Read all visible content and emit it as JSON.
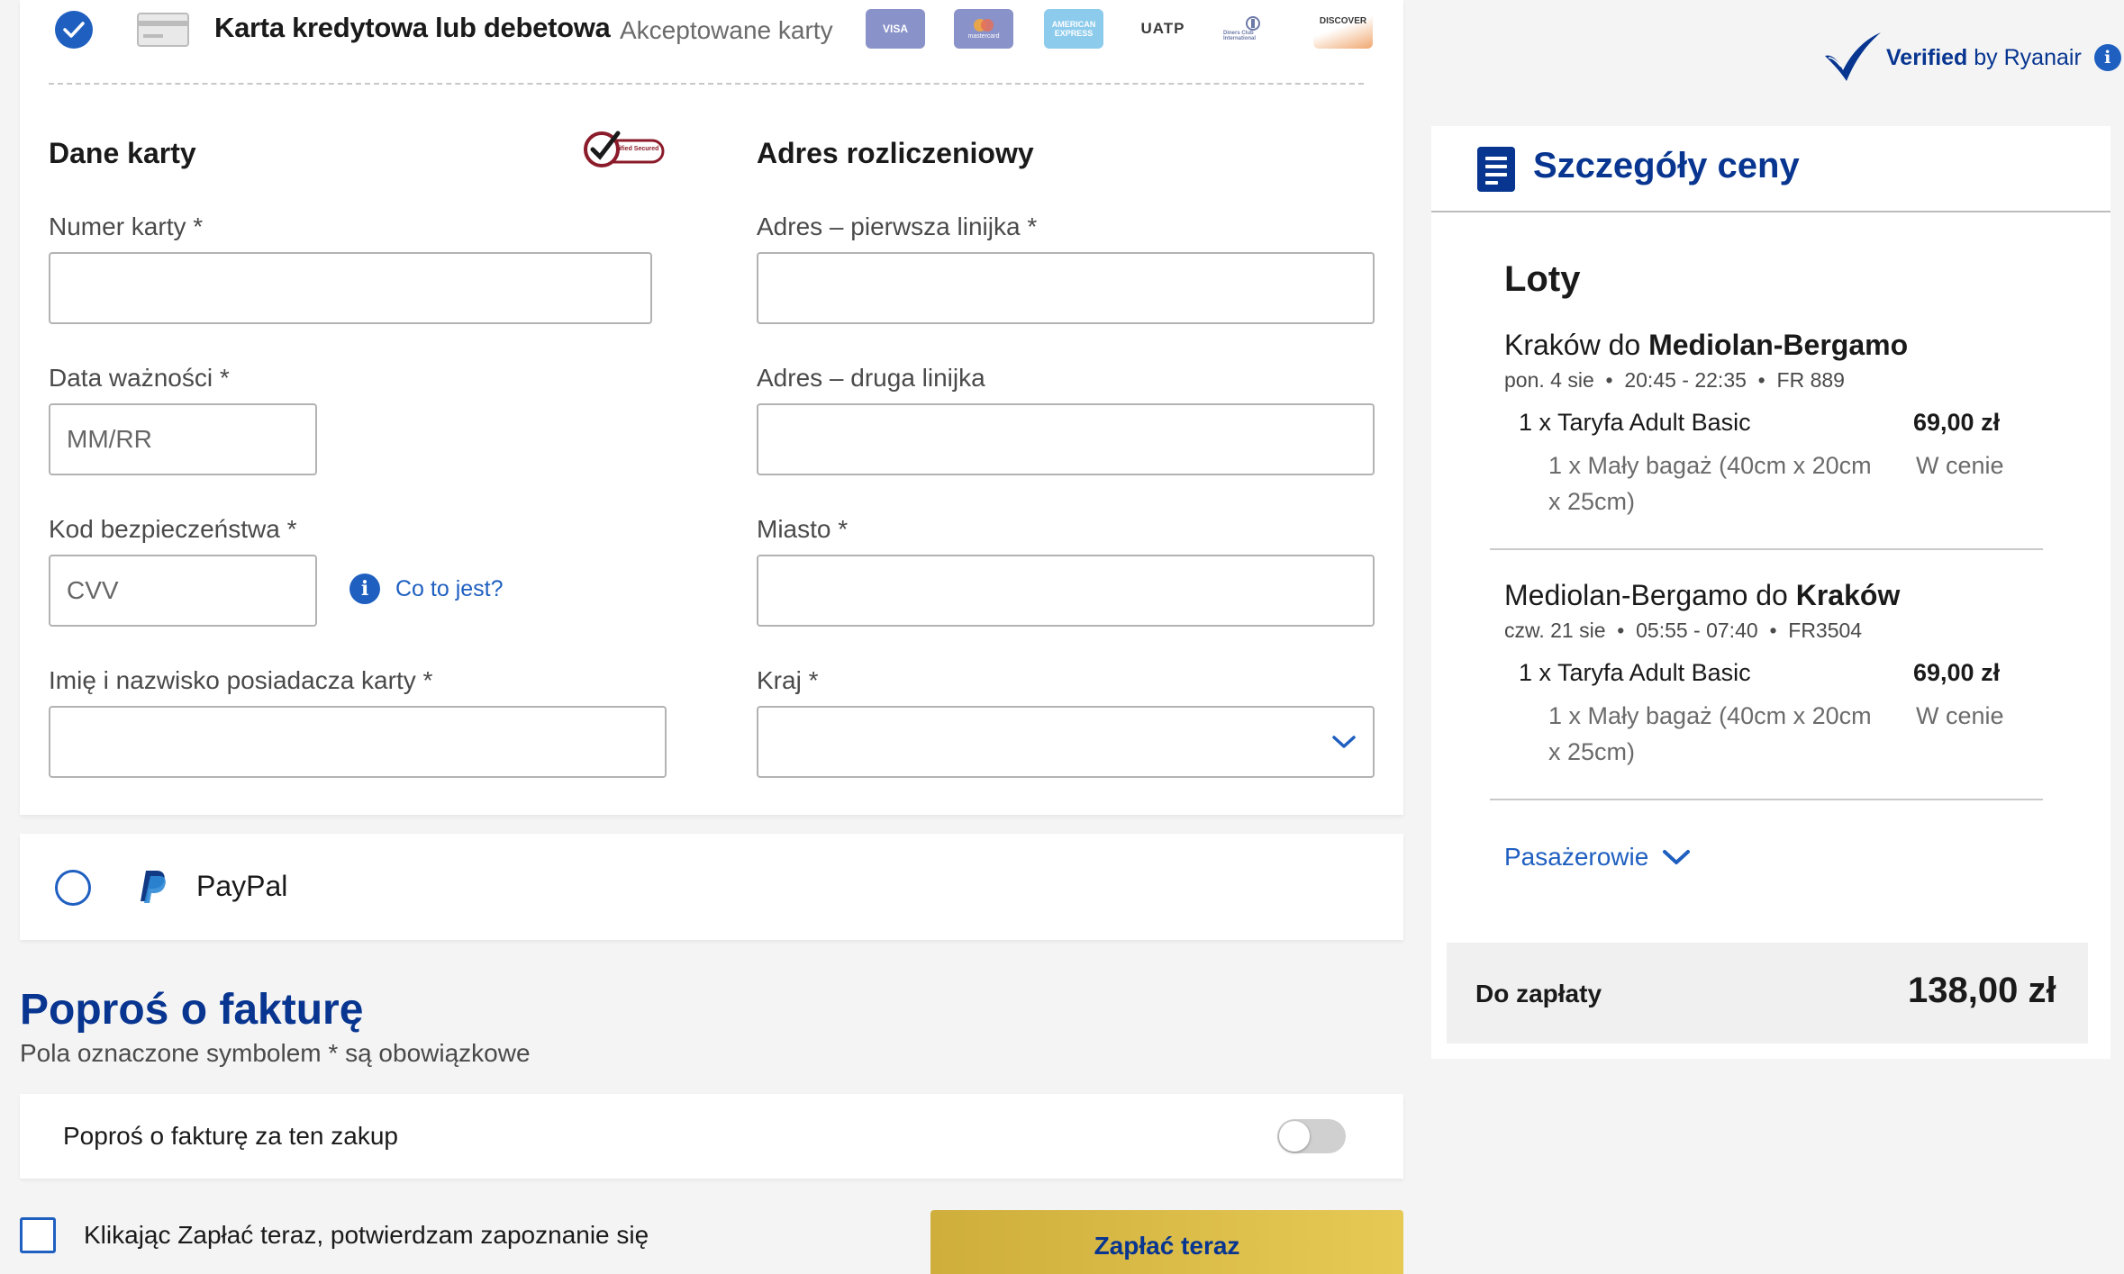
{
  "payment": {
    "method_title": "Karta kredytowa lub debetowa",
    "accepted_label": "Akceptowane karty",
    "card_logos": [
      "VISA",
      "mastercard",
      "AMERICAN EXPRESS",
      "UATP",
      "Diners Club International",
      "DISCOVER"
    ],
    "card_section": {
      "title": "Dane karty",
      "secure_badge": "Verified Secured",
      "card_number_label": "Numer karty *",
      "expiry_label": "Data ważności *",
      "expiry_placeholder": "MM/RR",
      "cvv_label": "Kod bezpieczeństwa *",
      "cvv_placeholder": "CVV",
      "cvv_help_link": "Co to jest?",
      "holder_label": "Imię i nazwisko posiadacza karty *"
    },
    "billing_section": {
      "title": "Adres rozliczeniowy",
      "address1_label": "Adres – pierwsza linijka *",
      "address2_label": "Adres – druga linijka",
      "city_label": "Miasto *",
      "country_label": "Kraj *"
    },
    "paypal_label": "PayPal"
  },
  "invoice": {
    "title": "Poproś o fakturę",
    "subtitle": "Pola oznaczone symbolem * są obowiązkowe",
    "toggle_label": "Poproś o fakturę za ten zakup",
    "toggle_on": false
  },
  "footer": {
    "terms_text": "Klikając Zapłać teraz, potwierdzam zapoznanie się",
    "pay_button": "Zapłać teraz"
  },
  "verified": {
    "bold": "Verified",
    "rest": " by Ryanair"
  },
  "price_details": {
    "title": "Szczegóły ceny",
    "flights_heading": "Loty",
    "flights": [
      {
        "from": "Kraków do ",
        "to": "Mediolan-Bergamo",
        "meta": "pon. 4 sie  •  20:45 - 22:35  •  FR 889",
        "fare": "1 x Taryfa Adult Basic",
        "fare_price": "69,00 zł",
        "bag_line1": "1 x Mały bagaż (40cm x 20cm",
        "bag_line2": "x 25cm)",
        "bag_price": "W cenie"
      },
      {
        "from": "Mediolan-Bergamo do ",
        "to": "Kraków",
        "meta": "czw. 21 sie  •  05:55 - 07:40  •  FR3504",
        "fare": "1 x Taryfa Adult Basic",
        "fare_price": "69,00 zł",
        "bag_line1": "1 x Mały bagaż (40cm x 20cm",
        "bag_line2": "x 25cm)",
        "bag_price": "W cenie"
      }
    ],
    "passengers_label": "Pasażerowie",
    "total_label": "Do zapłaty",
    "total_value": "138,00 zł"
  },
  "colors": {
    "brand_blue": "#073590",
    "link_blue": "#1f5fc0",
    "pay_button": "#e6c955"
  }
}
